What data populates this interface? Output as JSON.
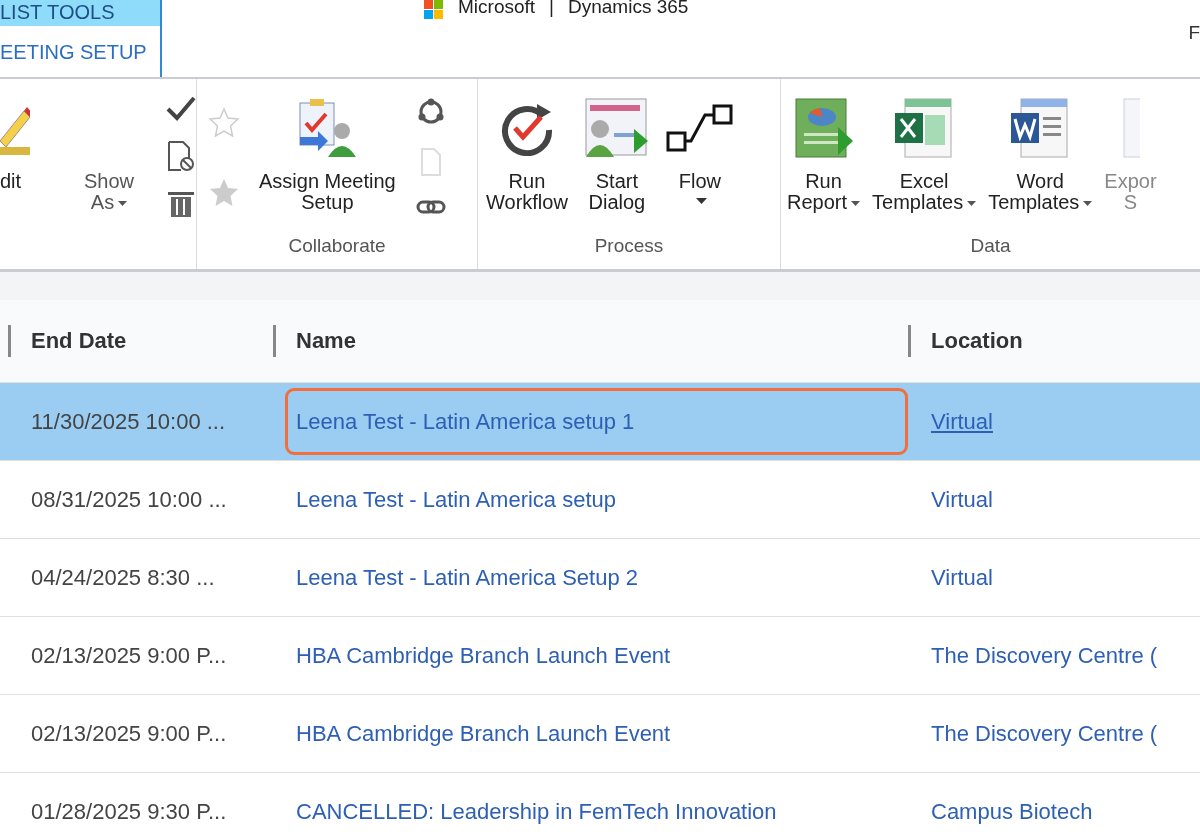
{
  "context_tabs": [
    {
      "label": "LIST TOOLS",
      "selected": true
    },
    {
      "label": "EETING SETUP",
      "selected": false
    }
  ],
  "brand": {
    "company": "Microsoft",
    "separator": "|",
    "product": "Dynamics 365",
    "cut_text": "F"
  },
  "ribbon": {
    "groups": [
      {
        "items": [
          {
            "kind": "large",
            "lines": [
              "dit"
            ],
            "dropdown": false,
            "disabled": false
          },
          {
            "kind": "large",
            "lines": [
              "Show",
              "As"
            ],
            "dropdown": true,
            "disabled": false
          },
          {
            "kind": "stack"
          }
        ]
      },
      {
        "label": "Collaborate",
        "items": [
          {
            "kind": "stack"
          },
          {
            "kind": "large",
            "lines": [
              "Assign Meeting",
              "Setup"
            ],
            "dropdown": false,
            "disabled": false
          },
          {
            "kind": "stack"
          }
        ]
      },
      {
        "label": "Process",
        "items": [
          {
            "kind": "large",
            "lines": [
              "Run",
              "Workflow"
            ],
            "dropdown": false,
            "disabled": false
          },
          {
            "kind": "large",
            "lines": [
              "Start",
              "Dialog"
            ],
            "dropdown": false,
            "disabled": false
          },
          {
            "kind": "large",
            "lines": [
              "Flow"
            ],
            "dropdown": true,
            "disabled": false
          }
        ]
      },
      {
        "label": "Data",
        "items": [
          {
            "kind": "large",
            "lines": [
              "Run",
              "Report"
            ],
            "dropdown": true,
            "disabled": false
          },
          {
            "kind": "large",
            "lines": [
              "Excel",
              "Templates"
            ],
            "dropdown": true,
            "disabled": false
          },
          {
            "kind": "large",
            "lines": [
              "Word",
              "Templates"
            ],
            "dropdown": true,
            "disabled": false
          },
          {
            "kind": "large",
            "lines": [
              "Expor",
              "S"
            ],
            "dropdown": false,
            "disabled": true
          }
        ]
      }
    ]
  },
  "table": {
    "columns": [
      "End Date",
      "Name",
      "Location"
    ],
    "rows": [
      {
        "end_date": "11/30/2025 10:00 ...",
        "name": "Leena Test - Latin America setup 1",
        "location": "Virtual",
        "selected": true,
        "highlighted": true
      },
      {
        "end_date": "08/31/2025 10:00 ...",
        "name": "Leena Test - Latin America setup",
        "location": "Virtual",
        "selected": false,
        "highlighted": false
      },
      {
        "end_date": "04/24/2025 8:30 ...",
        "name": "Leena Test - Latin America Setup 2",
        "location": "Virtual",
        "selected": false,
        "highlighted": false
      },
      {
        "end_date": "02/13/2025 9:00 P...",
        "name": "HBA Cambridge Branch Launch Event",
        "location": "The Discovery Centre (",
        "selected": false,
        "highlighted": false
      },
      {
        "end_date": "02/13/2025 9:00 P...",
        "name": "HBA Cambridge Branch Launch Event",
        "location": "The Discovery Centre (",
        "selected": false,
        "highlighted": false
      },
      {
        "end_date": "01/28/2025 9:30 P...",
        "name": "CANCELLED: Leadership in FemTech Innovation",
        "location": "Campus Biotech",
        "selected": false,
        "highlighted": false
      }
    ]
  }
}
